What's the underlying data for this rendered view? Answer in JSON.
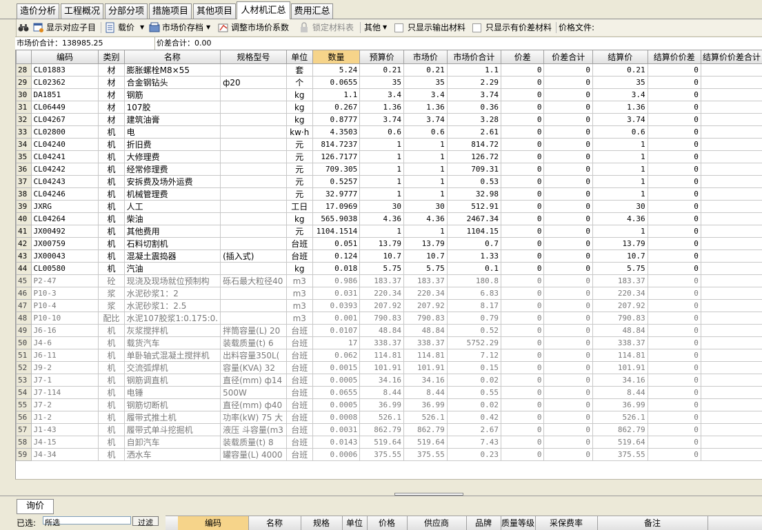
{
  "tabs": [
    "造价分析",
    "工程概况",
    "分部分项",
    "措施项目",
    "其他项目",
    "人材机汇总",
    "费用汇总"
  ],
  "active_tab_index": 5,
  "toolbar": {
    "find_icon": "binoculars-icon",
    "show_sub": "显示对应子目",
    "load_price": "载价",
    "market_archive": "市场价存档",
    "adjust_coef": "调整市场价系数",
    "lock_material": "锁定材料表",
    "other": "其他",
    "only_output": "只显示输出材料",
    "only_diff": "只显示有价差材料",
    "price_file": "价格文件:"
  },
  "summary": {
    "market_total": "市场价合计：138985.25",
    "diff_total": "价差合计：0.00"
  },
  "columns": [
    "编码",
    "类别",
    "名称",
    "规格型号",
    "单位",
    "数量",
    "预算价",
    "市场价",
    "市场价合计",
    "价差",
    "价差合计",
    "结算价",
    "结算价价差",
    "结算价价差合计"
  ],
  "highlight_column": "数量",
  "rows": [
    {
      "n": "28",
      "code": "CL01883",
      "cat": "材",
      "name": "膨胀螺栓M8×55",
      "spec": "",
      "unit": "套",
      "qty": "5.24",
      "budget": "0.21",
      "market": "0.21",
      "mtotal": "1.1",
      "diff": "0",
      "dtotal": "0",
      "settle": "0.21",
      "sdiff": "0",
      "gray": false
    },
    {
      "n": "29",
      "code": "CL02362",
      "cat": "材",
      "name": "合金钢钻头",
      "spec": "ф20",
      "unit": "个",
      "qty": "0.0655",
      "budget": "35",
      "market": "35",
      "mtotal": "2.29",
      "diff": "0",
      "dtotal": "0",
      "settle": "35",
      "sdiff": "0",
      "gray": false
    },
    {
      "n": "30",
      "code": "DA1851",
      "cat": "材",
      "name": "钢筋",
      "spec": "",
      "unit": "kg",
      "qty": "1.1",
      "budget": "3.4",
      "market": "3.4",
      "mtotal": "3.74",
      "diff": "0",
      "dtotal": "0",
      "settle": "3.4",
      "sdiff": "0",
      "gray": false
    },
    {
      "n": "31",
      "code": "CL06449",
      "cat": "材",
      "name": "107胶",
      "spec": "",
      "unit": "kg",
      "qty": "0.267",
      "budget": "1.36",
      "market": "1.36",
      "mtotal": "0.36",
      "diff": "0",
      "dtotal": "0",
      "settle": "1.36",
      "sdiff": "0",
      "gray": false
    },
    {
      "n": "32",
      "code": "CL04267",
      "cat": "材",
      "name": "建筑油膏",
      "spec": "",
      "unit": "kg",
      "qty": "0.8777",
      "budget": "3.74",
      "market": "3.74",
      "mtotal": "3.28",
      "diff": "0",
      "dtotal": "0",
      "settle": "3.74",
      "sdiff": "0",
      "gray": false
    },
    {
      "n": "33",
      "code": "CL02800",
      "cat": "机",
      "name": "电",
      "spec": "",
      "unit": "kw·h",
      "qty": "4.3503",
      "budget": "0.6",
      "market": "0.6",
      "mtotal": "2.61",
      "diff": "0",
      "dtotal": "0",
      "settle": "0.6",
      "sdiff": "0",
      "gray": false
    },
    {
      "n": "34",
      "code": "CL04240",
      "cat": "机",
      "name": "折旧费",
      "spec": "",
      "unit": "元",
      "qty": "814.7237",
      "budget": "1",
      "market": "1",
      "mtotal": "814.72",
      "diff": "0",
      "dtotal": "0",
      "settle": "1",
      "sdiff": "0",
      "gray": false
    },
    {
      "n": "35",
      "code": "CL04241",
      "cat": "机",
      "name": "大修理费",
      "spec": "",
      "unit": "元",
      "qty": "126.7177",
      "budget": "1",
      "market": "1",
      "mtotal": "126.72",
      "diff": "0",
      "dtotal": "0",
      "settle": "1",
      "sdiff": "0",
      "gray": false
    },
    {
      "n": "36",
      "code": "CL04242",
      "cat": "机",
      "name": "经常修理费",
      "spec": "",
      "unit": "元",
      "qty": "709.305",
      "budget": "1",
      "market": "1",
      "mtotal": "709.31",
      "diff": "0",
      "dtotal": "0",
      "settle": "1",
      "sdiff": "0",
      "gray": false
    },
    {
      "n": "37",
      "code": "CL04243",
      "cat": "机",
      "name": "安拆费及场外运费",
      "spec": "",
      "unit": "元",
      "qty": "0.5257",
      "budget": "1",
      "market": "1",
      "mtotal": "0.53",
      "diff": "0",
      "dtotal": "0",
      "settle": "1",
      "sdiff": "0",
      "gray": false
    },
    {
      "n": "38",
      "code": "CL04246",
      "cat": "机",
      "name": "机械管理费",
      "spec": "",
      "unit": "元",
      "qty": "32.9777",
      "budget": "1",
      "market": "1",
      "mtotal": "32.98",
      "diff": "0",
      "dtotal": "0",
      "settle": "1",
      "sdiff": "0",
      "gray": false
    },
    {
      "n": "39",
      "code": "JXRG",
      "cat": "机",
      "name": "人工",
      "spec": "",
      "unit": "工日",
      "qty": "17.0969",
      "budget": "30",
      "market": "30",
      "mtotal": "512.91",
      "diff": "0",
      "dtotal": "0",
      "settle": "30",
      "sdiff": "0",
      "gray": false
    },
    {
      "n": "40",
      "code": "CL04264",
      "cat": "机",
      "name": "柴油",
      "spec": "",
      "unit": "kg",
      "qty": "565.9038",
      "budget": "4.36",
      "market": "4.36",
      "mtotal": "2467.34",
      "diff": "0",
      "dtotal": "0",
      "settle": "4.36",
      "sdiff": "0",
      "gray": false
    },
    {
      "n": "41",
      "code": "JX00492",
      "cat": "机",
      "name": "其他费用",
      "spec": "",
      "unit": "元",
      "qty": "1104.1514",
      "budget": "1",
      "market": "1",
      "mtotal": "1104.15",
      "diff": "0",
      "dtotal": "0",
      "settle": "1",
      "sdiff": "0",
      "gray": false
    },
    {
      "n": "42",
      "code": "JX00759",
      "cat": "机",
      "name": "石料切割机",
      "spec": "",
      "unit": "台班",
      "qty": "0.051",
      "budget": "13.79",
      "market": "13.79",
      "mtotal": "0.7",
      "diff": "0",
      "dtotal": "0",
      "settle": "13.79",
      "sdiff": "0",
      "gray": false
    },
    {
      "n": "43",
      "code": "JX00043",
      "cat": "机",
      "name": "混凝土震捣器",
      "spec": "(插入式)",
      "unit": "台班",
      "qty": "0.124",
      "budget": "10.7",
      "market": "10.7",
      "mtotal": "1.33",
      "diff": "0",
      "dtotal": "0",
      "settle": "10.7",
      "sdiff": "0",
      "gray": false
    },
    {
      "n": "44",
      "code": "CL00580",
      "cat": "机",
      "name": "汽油",
      "spec": "",
      "unit": "kg",
      "qty": "0.018",
      "budget": "5.75",
      "market": "5.75",
      "mtotal": "0.1",
      "diff": "0",
      "dtotal": "0",
      "settle": "5.75",
      "sdiff": "0",
      "gray": false
    },
    {
      "n": "45",
      "code": "P2-47",
      "cat": "砼",
      "name": "现浇及现场就位预制构",
      "spec": "砾石最大粒径40",
      "unit": "m3",
      "qty": "0.986",
      "budget": "183.37",
      "market": "183.37",
      "mtotal": "180.8",
      "diff": "0",
      "dtotal": "0",
      "settle": "183.37",
      "sdiff": "0",
      "gray": true
    },
    {
      "n": "46",
      "code": "P10-3",
      "cat": "浆",
      "name": "水泥砂浆1：2",
      "spec": "",
      "unit": "m3",
      "qty": "0.031",
      "budget": "220.34",
      "market": "220.34",
      "mtotal": "6.83",
      "diff": "0",
      "dtotal": "0",
      "settle": "220.34",
      "sdiff": "0",
      "gray": true
    },
    {
      "n": "47",
      "code": "P10-4",
      "cat": "浆",
      "name": "水泥砂浆1：2.5",
      "spec": "",
      "unit": "m3",
      "qty": "0.0393",
      "budget": "207.92",
      "market": "207.92",
      "mtotal": "8.17",
      "diff": "0",
      "dtotal": "0",
      "settle": "207.92",
      "sdiff": "0",
      "gray": true
    },
    {
      "n": "48",
      "code": "P10-10",
      "cat": "配比",
      "name": "水泥107胶浆1:0.175:0.",
      "spec": "",
      "unit": "m3",
      "qty": "0.001",
      "budget": "790.83",
      "market": "790.83",
      "mtotal": "0.79",
      "diff": "0",
      "dtotal": "0",
      "settle": "790.83",
      "sdiff": "0",
      "gray": true
    },
    {
      "n": "49",
      "code": "J6-16",
      "cat": "机",
      "name": "灰浆搅拌机",
      "spec": "拌筒容量(L) 20",
      "unit": "台班",
      "qty": "0.0107",
      "budget": "48.84",
      "market": "48.84",
      "mtotal": "0.52",
      "diff": "0",
      "dtotal": "0",
      "settle": "48.84",
      "sdiff": "0",
      "gray": true
    },
    {
      "n": "50",
      "code": "J4-6",
      "cat": "机",
      "name": "载货汽车",
      "spec": "装载质量(t) 6",
      "unit": "台班",
      "qty": "17",
      "budget": "338.37",
      "market": "338.37",
      "mtotal": "5752.29",
      "diff": "0",
      "dtotal": "0",
      "settle": "338.37",
      "sdiff": "0",
      "gray": true
    },
    {
      "n": "51",
      "code": "J6-11",
      "cat": "机",
      "name": "单卧轴式混凝土搅拌机",
      "spec": "出料容量350L(",
      "unit": "台班",
      "qty": "0.062",
      "budget": "114.81",
      "market": "114.81",
      "mtotal": "7.12",
      "diff": "0",
      "dtotal": "0",
      "settle": "114.81",
      "sdiff": "0",
      "gray": true
    },
    {
      "n": "52",
      "code": "J9-2",
      "cat": "机",
      "name": "交流弧焊机",
      "spec": "容量(KVA) 32",
      "unit": "台班",
      "qty": "0.0015",
      "budget": "101.91",
      "market": "101.91",
      "mtotal": "0.15",
      "diff": "0",
      "dtotal": "0",
      "settle": "101.91",
      "sdiff": "0",
      "gray": true
    },
    {
      "n": "53",
      "code": "J7-1",
      "cat": "机",
      "name": "钢筋调直机",
      "spec": "直径(mm) ф14",
      "unit": "台班",
      "qty": "0.0005",
      "budget": "34.16",
      "market": "34.16",
      "mtotal": "0.02",
      "diff": "0",
      "dtotal": "0",
      "settle": "34.16",
      "sdiff": "0",
      "gray": true
    },
    {
      "n": "54",
      "code": "J7-114",
      "cat": "机",
      "name": "电锤",
      "spec": "500W",
      "unit": "台班",
      "qty": "0.0655",
      "budget": "8.44",
      "market": "8.44",
      "mtotal": "0.55",
      "diff": "0",
      "dtotal": "0",
      "settle": "8.44",
      "sdiff": "0",
      "gray": true
    },
    {
      "n": "55",
      "code": "J7-2",
      "cat": "机",
      "name": "钢筋切断机",
      "spec": "直径(mm) ф40",
      "unit": "台班",
      "qty": "0.0005",
      "budget": "36.99",
      "market": "36.99",
      "mtotal": "0.02",
      "diff": "0",
      "dtotal": "0",
      "settle": "36.99",
      "sdiff": "0",
      "gray": true
    },
    {
      "n": "56",
      "code": "J1-2",
      "cat": "机",
      "name": "履带式推土机",
      "spec": "功率(kW) 75 大",
      "unit": "台班",
      "qty": "0.0008",
      "budget": "526.1",
      "market": "526.1",
      "mtotal": "0.42",
      "diff": "0",
      "dtotal": "0",
      "settle": "526.1",
      "sdiff": "0",
      "gray": true
    },
    {
      "n": "57",
      "code": "J1-43",
      "cat": "机",
      "name": "履带式单斗挖掘机",
      "spec": "液压 斗容量(m3",
      "unit": "台班",
      "qty": "0.0031",
      "budget": "862.79",
      "market": "862.79",
      "mtotal": "2.67",
      "diff": "0",
      "dtotal": "0",
      "settle": "862.79",
      "sdiff": "0",
      "gray": true
    },
    {
      "n": "58",
      "code": "J4-15",
      "cat": "机",
      "name": "自卸汽车",
      "spec": "装载质量(t) 8",
      "unit": "台班",
      "qty": "0.0143",
      "budget": "519.64",
      "market": "519.64",
      "mtotal": "7.43",
      "diff": "0",
      "dtotal": "0",
      "settle": "519.64",
      "sdiff": "0",
      "gray": true
    },
    {
      "n": "59",
      "code": "J4-34",
      "cat": "机",
      "name": "洒水车",
      "spec": "罐容量(L) 4000",
      "unit": "台班",
      "qty": "0.0006",
      "budget": "375.55",
      "market": "375.55",
      "mtotal": "0.23",
      "diff": "0",
      "dtotal": "0",
      "settle": "375.55",
      "sdiff": "0",
      "gray": true
    }
  ],
  "bottom": {
    "tab": "询价",
    "field_label": "已选:",
    "field_value": "所选",
    "button": "过滤",
    "columns": [
      "编码",
      "名称",
      "规格",
      "单位",
      "价格",
      "供应商",
      "品牌",
      "质量等级",
      "采保费率",
      "备注"
    ]
  },
  "colors": {
    "highlight": "#f6d48a",
    "window": "#ece9d8"
  }
}
